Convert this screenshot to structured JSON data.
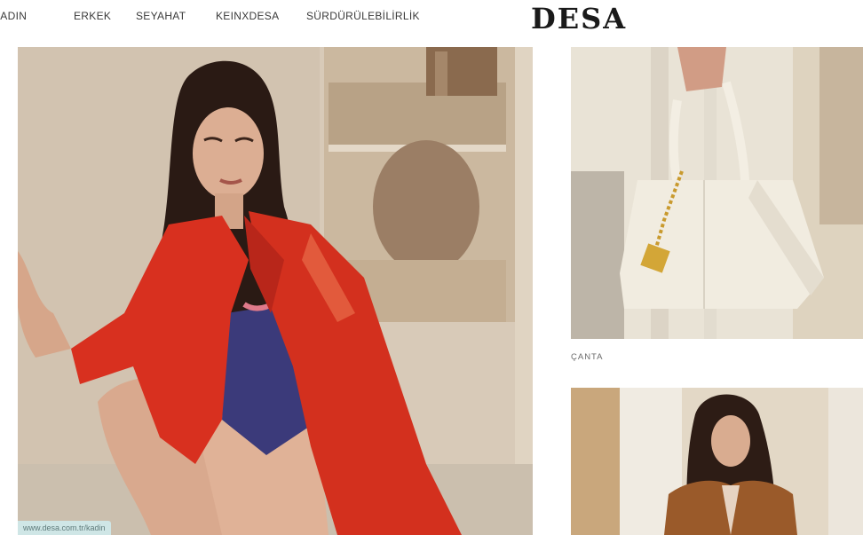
{
  "nav": {
    "items": [
      {
        "label": "KADIN"
      },
      {
        "label": "ERKEK"
      },
      {
        "label": "SEYAHAT"
      },
      {
        "label": "KEINxDESA"
      },
      {
        "label": "SÜRDÜRÜLEBİLİRLİK"
      }
    ],
    "logo": "DESA"
  },
  "right_column": {
    "bag_caption": "ÇANTA"
  },
  "status_bar": {
    "url": "www.desa.com.tr/kadin"
  },
  "colors": {
    "jacket_red": "#d8301f",
    "bag_cream": "#f1ece0",
    "wall_beige": "#d6c7b4",
    "status_teal": "#cfe6e6"
  }
}
